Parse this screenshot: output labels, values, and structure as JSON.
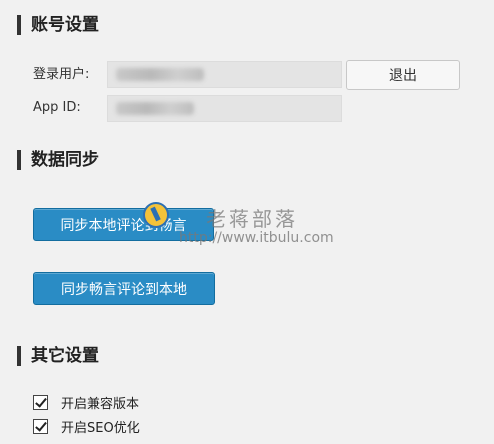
{
  "account": {
    "title": "账号设置",
    "user_label": "登录用户:",
    "appid_label": "App ID:",
    "logout_label": "退出"
  },
  "sync": {
    "title": "数据同步",
    "sync_local_label": "同步本地评论到畅言",
    "sync_remote_label": "同步畅言评论到本地"
  },
  "other": {
    "title": "其它设置",
    "options": [
      {
        "label": "开启兼容版本",
        "checked": true
      },
      {
        "label": "开启SEO优化",
        "checked": true
      }
    ]
  },
  "watermark": {
    "title": "老蒋部落",
    "url": "http://www.itbulu.com"
  }
}
